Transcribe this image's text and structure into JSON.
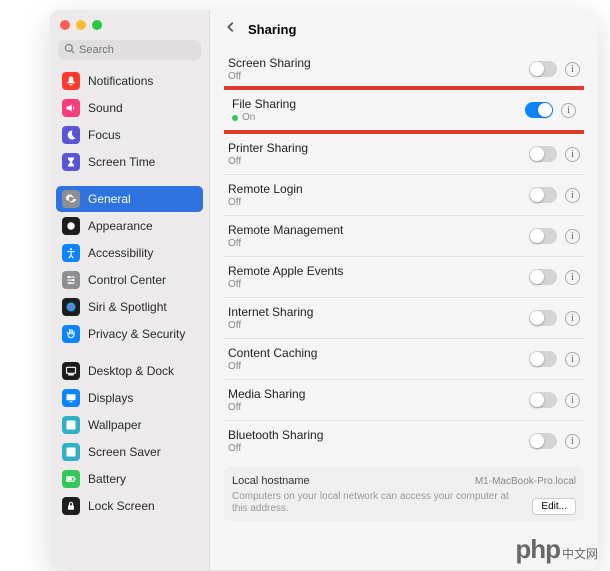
{
  "search": {
    "placeholder": "Search"
  },
  "header": {
    "title": "Sharing"
  },
  "sidebar": {
    "items": [
      {
        "label": "Notifications",
        "icon": "bell",
        "color": "#ff3b30"
      },
      {
        "label": "Sound",
        "icon": "speaker",
        "color": "#ff3b7f"
      },
      {
        "label": "Focus",
        "icon": "moon",
        "color": "#5856d6"
      },
      {
        "label": "Screen Time",
        "icon": "hourglass",
        "color": "#5856d6"
      },
      {
        "label": "General",
        "icon": "gear",
        "color": "#8e8e93",
        "selected": true
      },
      {
        "label": "Appearance",
        "icon": "appearance",
        "color": "#1d1d1f"
      },
      {
        "label": "Accessibility",
        "icon": "access",
        "color": "#0a84ff"
      },
      {
        "label": "Control Center",
        "icon": "sliders",
        "color": "#8e8e93"
      },
      {
        "label": "Siri & Spotlight",
        "icon": "siri",
        "color": "#1d1d1f"
      },
      {
        "label": "Privacy & Security",
        "icon": "hand",
        "color": "#0a84ff"
      },
      {
        "label": "Desktop & Dock",
        "icon": "dock",
        "color": "#1d1d1f"
      },
      {
        "label": "Displays",
        "icon": "display",
        "color": "#0a84ff"
      },
      {
        "label": "Wallpaper",
        "icon": "wallpaper",
        "color": "#30b0c7"
      },
      {
        "label": "Screen Saver",
        "icon": "saver",
        "color": "#30b0c7"
      },
      {
        "label": "Battery",
        "icon": "battery",
        "color": "#34c759"
      },
      {
        "label": "Lock Screen",
        "icon": "lock",
        "color": "#1d1d1f"
      }
    ]
  },
  "rows": [
    {
      "label": "Screen Sharing",
      "status": "Off",
      "on": false
    },
    {
      "label": "File Sharing",
      "status": "On",
      "on": true,
      "highlight": true
    },
    {
      "label": "Printer Sharing",
      "status": "Off",
      "on": false
    },
    {
      "label": "Remote Login",
      "status": "Off",
      "on": false
    },
    {
      "label": "Remote Management",
      "status": "Off",
      "on": false
    },
    {
      "label": "Remote Apple Events",
      "status": "Off",
      "on": false
    },
    {
      "label": "Internet Sharing",
      "status": "Off",
      "on": false
    },
    {
      "label": "Content Caching",
      "status": "Off",
      "on": false
    },
    {
      "label": "Media Sharing",
      "status": "Off",
      "on": false
    },
    {
      "label": "Bluetooth Sharing",
      "status": "Off",
      "on": false
    }
  ],
  "local": {
    "label": "Local hostname",
    "value": "M1-MacBook-Pro.local",
    "desc": "Computers on your local network can access your computer at this address.",
    "edit": "Edit..."
  },
  "watermark": {
    "brand": "php",
    "suffix": "中文网"
  }
}
